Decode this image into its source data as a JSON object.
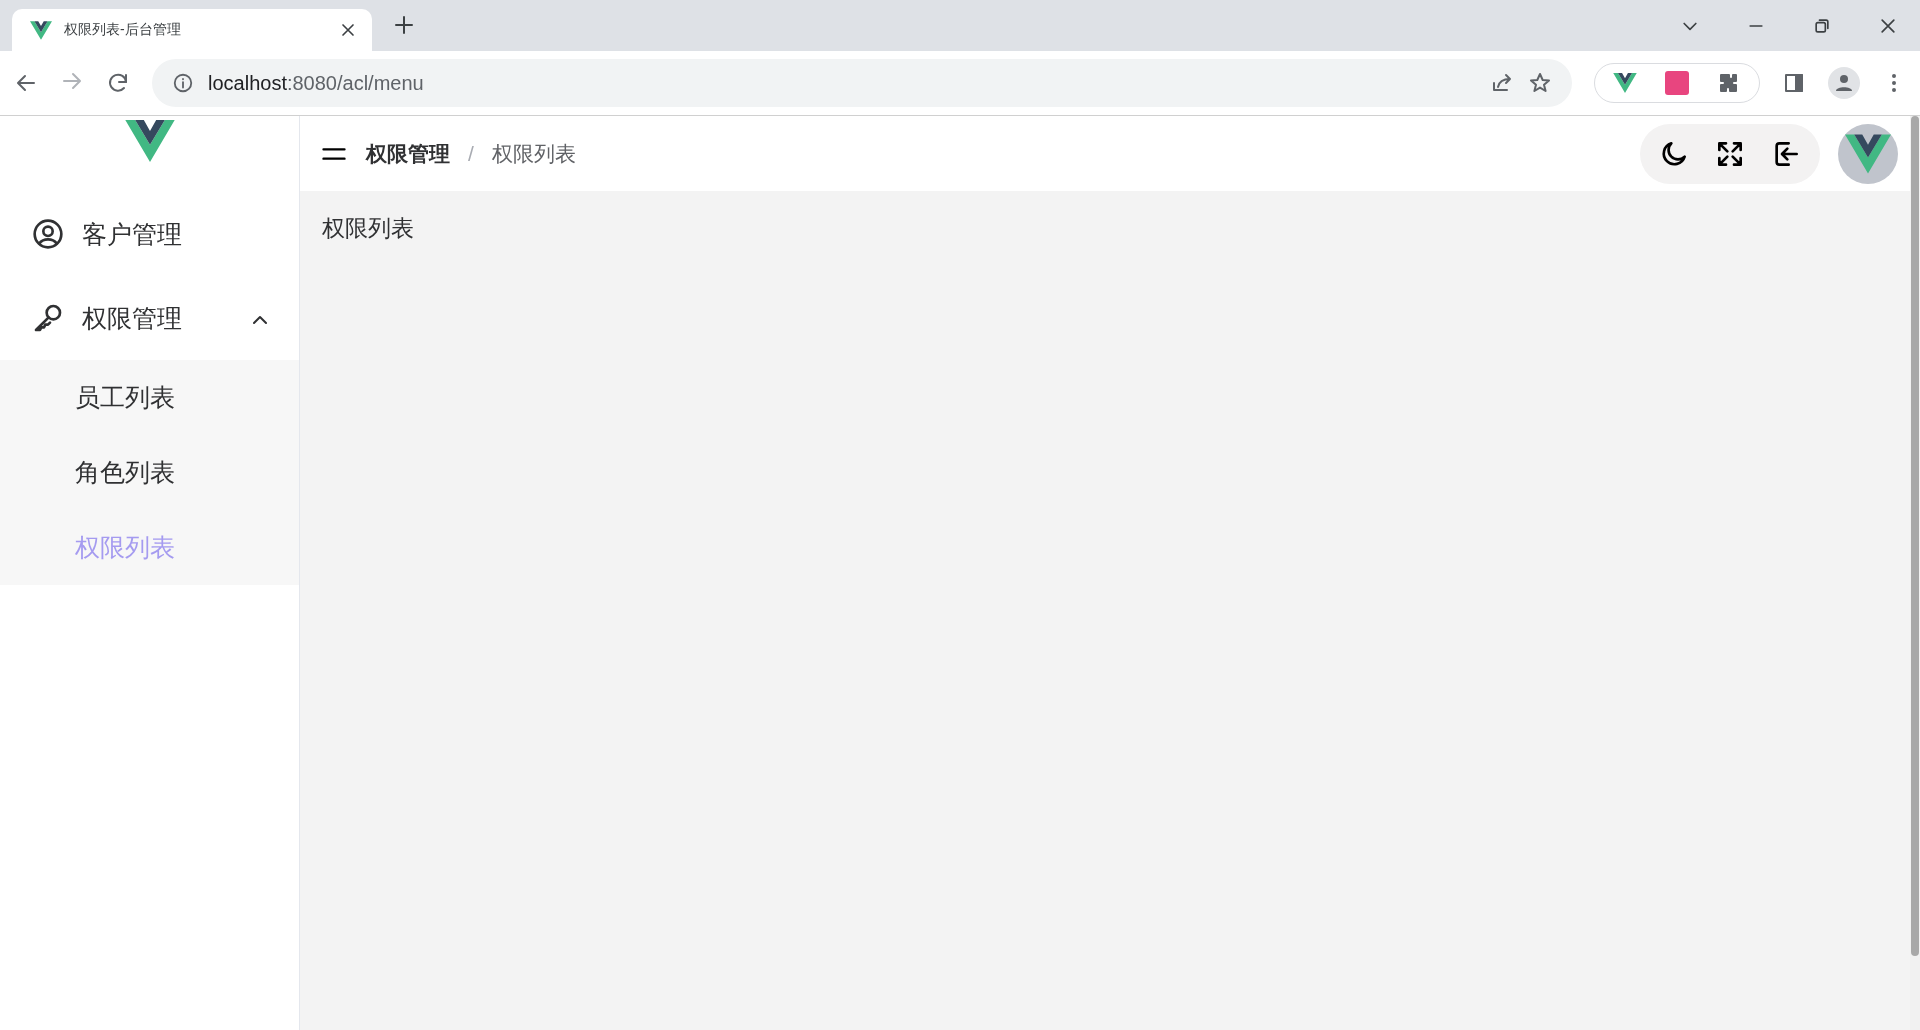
{
  "browser": {
    "tab": {
      "title": "权限列表-后台管理",
      "selected": true
    },
    "address": {
      "host": "localhost",
      "path": ":8080/acl/menu"
    }
  },
  "sidebar": {
    "items": [
      {
        "kind": "link",
        "label": "客户管理"
      },
      {
        "kind": "submenu",
        "label": "权限管理",
        "expanded": true,
        "children": [
          {
            "label": "员工列表",
            "selected": false
          },
          {
            "label": "角色列表",
            "selected": false
          },
          {
            "label": "权限列表",
            "selected": true
          }
        ]
      }
    ]
  },
  "header": {
    "breadcrumb": [
      {
        "label": "权限管理"
      },
      {
        "label": "权限列表"
      }
    ],
    "separator": "/"
  },
  "content": {
    "title": "权限列表"
  }
}
